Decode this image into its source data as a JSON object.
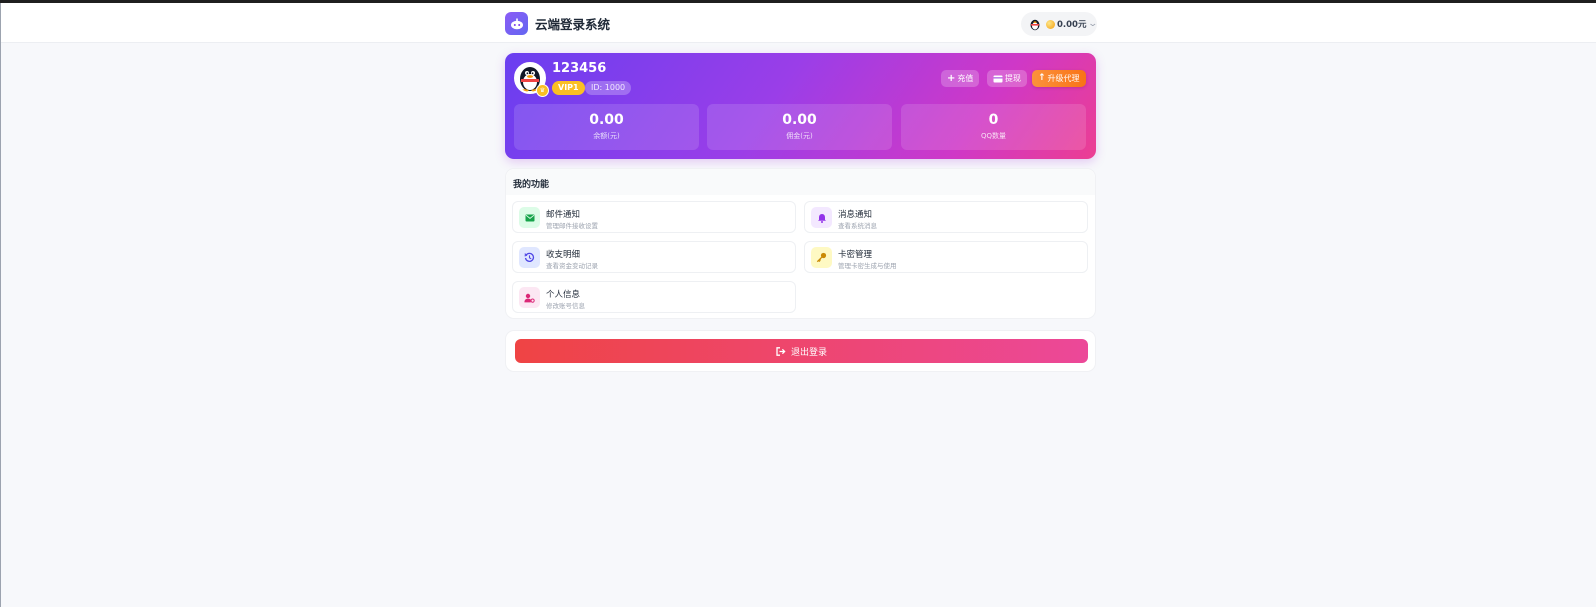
{
  "navbar": {
    "brand_title": "云端登录系统",
    "balance": "0.00元"
  },
  "profile": {
    "username": "123456",
    "vip_level": "VIP1",
    "user_id": "ID: 1000",
    "buttons": {
      "recharge": "充值",
      "withdraw": "提现",
      "upgrade": "升级代理"
    },
    "stats": [
      {
        "value": "0.00",
        "label": "余额(元)"
      },
      {
        "value": "0.00",
        "label": "佣金(元)"
      },
      {
        "value": "0",
        "label": "QQ数量"
      }
    ]
  },
  "functions": {
    "title": "我的功能",
    "items": [
      {
        "name": "邮件通知",
        "desc": "管理邮件接收设置",
        "icon": "mail-icon",
        "color": "#16a34a",
        "bg": "#dcfce7"
      },
      {
        "name": "消息通知",
        "desc": "查看系统消息",
        "icon": "bell-icon",
        "color": "#9333ea",
        "bg": "#f3e8ff"
      },
      {
        "name": "收支明细",
        "desc": "查看资金变动记录",
        "icon": "history-icon",
        "color": "#4f46e5",
        "bg": "#e0e7ff"
      },
      {
        "name": "卡密管理",
        "desc": "管理卡密生成与使用",
        "icon": "key-icon",
        "color": "#ca8a04",
        "bg": "#fef9c3"
      },
      {
        "name": "个人信息",
        "desc": "修改账号信息",
        "icon": "user-gear-icon",
        "color": "#db2777",
        "bg": "#fce7f3"
      }
    ]
  },
  "logout": {
    "label": "退出登录"
  }
}
